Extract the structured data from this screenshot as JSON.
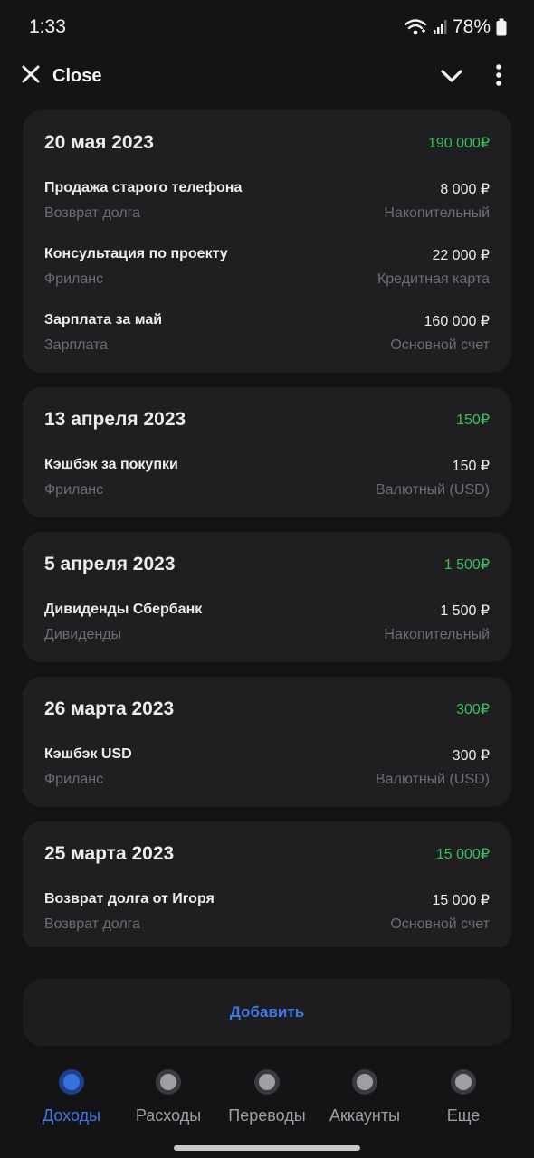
{
  "status_bar": {
    "time": "1:33",
    "battery": "78%",
    "icons": [
      "wifi-icon",
      "signal-icon",
      "battery-icon"
    ]
  },
  "top_bar": {
    "close_label": "Close",
    "icons": [
      "close-icon",
      "chevron-down-icon",
      "more-vertical-icon"
    ]
  },
  "groups": [
    {
      "date": "20 мая 2023",
      "total": "190 000₽",
      "items": [
        {
          "title": "Продажа старого телефона",
          "amount": "8 000 ₽",
          "category": "Возврат долга",
          "account": "Накопительный"
        },
        {
          "title": "Консультация по проекту",
          "amount": "22 000 ₽",
          "category": "Фриланс",
          "account": "Кредитная карта"
        },
        {
          "title": "Зарплата за май",
          "amount": "160 000 ₽",
          "category": "Зарплата",
          "account": "Основной счет"
        }
      ]
    },
    {
      "date": "13 апреля 2023",
      "total": "150₽",
      "items": [
        {
          "title": "Кэшбэк за покупки",
          "amount": "150 ₽",
          "category": "Фриланс",
          "account": "Валютный (USD)"
        }
      ]
    },
    {
      "date": "5 апреля 2023",
      "total": "1 500₽",
      "items": [
        {
          "title": "Дивиденды Сбербанк",
          "amount": "1 500 ₽",
          "category": "Дивиденды",
          "account": "Накопительный"
        }
      ]
    },
    {
      "date": "26 марта 2023",
      "total": "300₽",
      "items": [
        {
          "title": "Кэшбэк USD",
          "amount": "300 ₽",
          "category": "Фриланс",
          "account": "Валютный (USD)"
        }
      ]
    },
    {
      "date": "25 марта 2023",
      "total": "15 000₽",
      "items": [
        {
          "title": "Возврат долга от Игоря",
          "amount": "15 000 ₽",
          "category": "Возврат долга",
          "account": "Основной счет"
        }
      ]
    }
  ],
  "add_button": {
    "label": "Добавить"
  },
  "tabs": [
    {
      "label": "Доходы",
      "active": true
    },
    {
      "label": "Расходы",
      "active": false
    },
    {
      "label": "Переводы",
      "active": false
    },
    {
      "label": "Аккаунты",
      "active": false
    },
    {
      "label": "Еще",
      "active": false
    }
  ],
  "colors": {
    "background": "#141416",
    "card": "#1f1f22",
    "accent": "#3d79e6",
    "income": "#33c25a",
    "muted": "#6d6d72"
  }
}
